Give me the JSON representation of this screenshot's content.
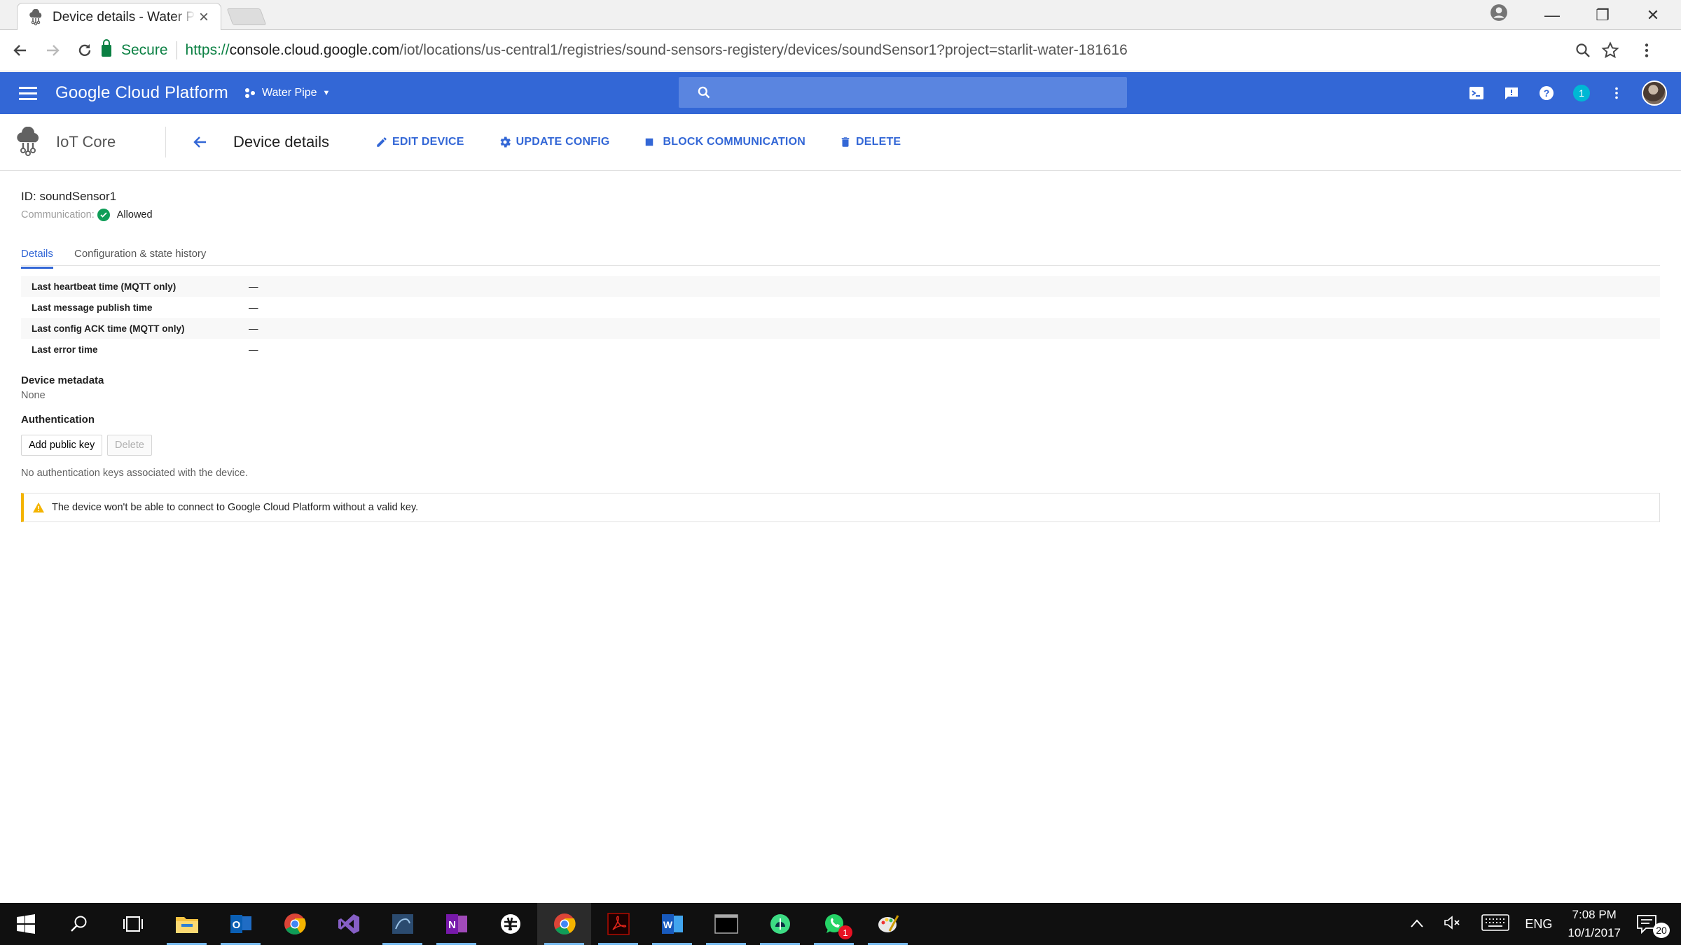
{
  "browser": {
    "tab_title": "Device details - Water Pipe",
    "tab_close": "×",
    "secure_label": "Secure",
    "url_proto": "https://",
    "url_host": "console.cloud.google.com",
    "url_path": "/iot/locations/us-central1/registries/sound-sensors-registery/devices/soundSensor1?project=starlit-water-181616",
    "window_controls": [
      "—",
      "❐",
      "✕"
    ]
  },
  "appbar": {
    "title": "Google Cloud Platform",
    "project": "Water Pipe",
    "notification_count": "1",
    "accent": "#3367d6"
  },
  "header": {
    "product": "IoT Core",
    "page_title": "Device details",
    "actions": {
      "edit": "EDIT DEVICE",
      "update": "UPDATE CONFIG",
      "block": "BLOCK COMMUNICATION",
      "delete": "DELETE"
    }
  },
  "device": {
    "id": "ID: soundSensor1",
    "communication_label": "Communication:",
    "communication_value": "Allowed"
  },
  "tabs": [
    "Details",
    "Configuration & state history"
  ],
  "properties": [
    {
      "key": "Last heartbeat time (MQTT only)",
      "value": "—"
    },
    {
      "key": "Last message publish time",
      "value": "—"
    },
    {
      "key": "Last config ACK time (MQTT only)",
      "value": "—"
    },
    {
      "key": "Last error time",
      "value": "—"
    }
  ],
  "metadata": {
    "heading": "Device metadata",
    "value": "None"
  },
  "auth": {
    "heading": "Authentication",
    "add_button": "Add public key",
    "delete_button": "Delete",
    "empty_text": "No authentication keys associated with the device.",
    "warning": "The device won't be able to connect to Google Cloud Platform without a valid key."
  },
  "taskbar": {
    "time": "7:08 PM",
    "date": "10/1/2017",
    "lang": "ENG",
    "whatsapp_badge": "1",
    "action_center_count": "20"
  }
}
